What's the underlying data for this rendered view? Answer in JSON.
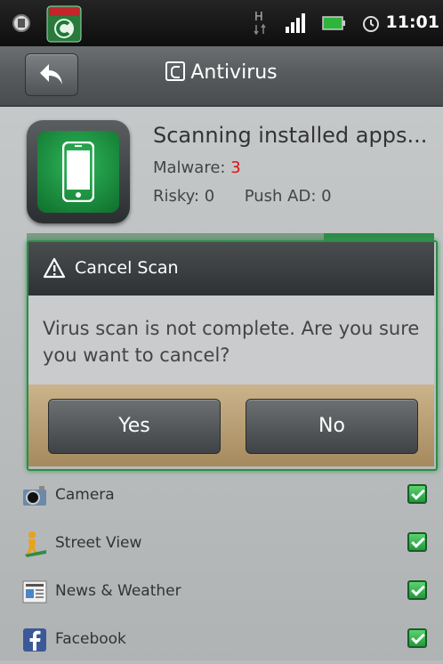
{
  "status_bar": {
    "clock": "11:01"
  },
  "header": {
    "title": "Antivirus"
  },
  "scan": {
    "status": "Scanning installed apps...",
    "malware_label": "Malware:",
    "malware_value": "3",
    "risky": "Risky: 0",
    "push_ad": "Push AD: 0"
  },
  "dialog": {
    "title": "Cancel Scan",
    "message": "Virus scan is not complete. Are you sure you want to cancel?",
    "yes": "Yes",
    "no": "No"
  },
  "apps": [
    {
      "name": "Camera",
      "icon": "camera-app-icon",
      "checked": true
    },
    {
      "name": "Street View",
      "icon": "street-view-app-icon",
      "checked": true
    },
    {
      "name": "News & Weather",
      "icon": "news-weather-app-icon",
      "checked": true
    },
    {
      "name": "Facebook",
      "icon": "facebook-app-icon",
      "checked": true
    }
  ],
  "colors": {
    "accent_green": "#2e8c48",
    "malware_red": "#d81515"
  }
}
